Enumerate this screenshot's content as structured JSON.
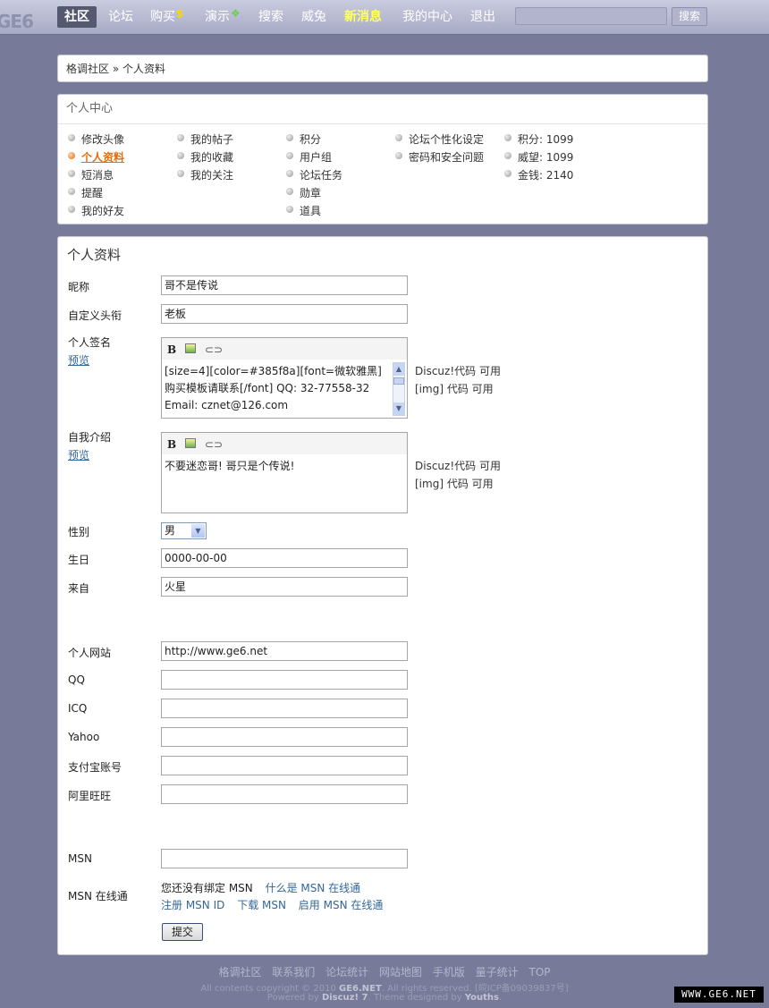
{
  "brand": {
    "logo": "GE6"
  },
  "nav": {
    "items": [
      {
        "label": "社区",
        "active": true
      },
      {
        "label": "论坛"
      },
      {
        "label": "购买",
        "badge": "$"
      },
      {
        "label": "演示",
        "badge": "❖"
      },
      {
        "label": "搜索"
      },
      {
        "label": "威兔"
      },
      {
        "label": "新消息",
        "highlight": true
      },
      {
        "label": "我的中心"
      },
      {
        "label": "退出"
      }
    ],
    "search_placeholder": "",
    "search_button": "搜索"
  },
  "breadcrumb": {
    "home": "格调社区",
    "sep": "»",
    "current": "个人资料"
  },
  "center": {
    "title": "个人中心",
    "columns": [
      [
        "修改头像",
        "个人资料",
        "短消息",
        "提醒",
        "我的好友"
      ],
      [
        "我的帖子",
        "我的收藏",
        "我的关注"
      ],
      [
        "积分",
        "用户组",
        "论坛任务",
        "勋章",
        "道具"
      ],
      [
        "论坛个性化设定",
        "密码和安全问题"
      ],
      [
        "积分: 1099",
        "威望: 1099",
        "金钱: 2140"
      ]
    ],
    "current_item": "个人资料"
  },
  "form": {
    "title": "个人资料",
    "nickname": {
      "label": "昵称",
      "value": "哥不是传说"
    },
    "custom_title": {
      "label": "自定义头衔",
      "value": "老板"
    },
    "signature": {
      "label": "个人签名",
      "preview": "预览",
      "value": "[size=4][color=#385f8a][font=微软雅黑]\n购买模板请联系[/font] QQ: 32-77558-32\nEmail: cznet@126.com"
    },
    "bio": {
      "label": "自我介绍",
      "preview": "预览",
      "value": "不要迷恋哥! 哥只是个传说!"
    },
    "hint_discuz": "Discuz!代码 可用",
    "hint_img": "[img] 代码 可用",
    "gender": {
      "label": "性别",
      "value": "男"
    },
    "birthday": {
      "label": "生日",
      "value": "0000-00-00"
    },
    "location": {
      "label": "来自",
      "value": "火星"
    },
    "website": {
      "label": "个人网站",
      "value": "http://www.ge6.net"
    },
    "qq": {
      "label": "QQ",
      "value": ""
    },
    "icq": {
      "label": "ICQ",
      "value": ""
    },
    "yahoo": {
      "label": "Yahoo",
      "value": ""
    },
    "alipay": {
      "label": "支付宝账号",
      "value": ""
    },
    "aliwangwang": {
      "label": "阿里旺旺",
      "value": ""
    },
    "msn": {
      "label": "MSN",
      "value": ""
    },
    "msn_online": {
      "label": "MSN 在线通",
      "status": "您还没有绑定 MSN",
      "what_link": "什么是 MSN 在线通",
      "register": "注册 MSN ID",
      "download": "下载 MSN",
      "enable": "启用 MSN 在线通"
    },
    "submit": "提交"
  },
  "footer": {
    "links": [
      "格调社区",
      "联系我们",
      "论坛统计",
      "网站地图",
      "手机版",
      "量子统计",
      "TOP"
    ],
    "copyright_pre": "All contents copyright © 2010",
    "copyright_site": "GE6.NET",
    "copyright_post": ". All rights reserved. [皖ICP备09039837号]",
    "powered_pre": "Powered by",
    "powered_product": "Discuz! 7",
    "powered_mid": ". Theme designed by",
    "powered_author": "Youths",
    "powered_end": "."
  },
  "watermark": "WWW.GE6.NET",
  "colors": {
    "background": "#777a99",
    "accent": "#e46c0a",
    "link": "#336699",
    "highlight": "#ffff66"
  }
}
